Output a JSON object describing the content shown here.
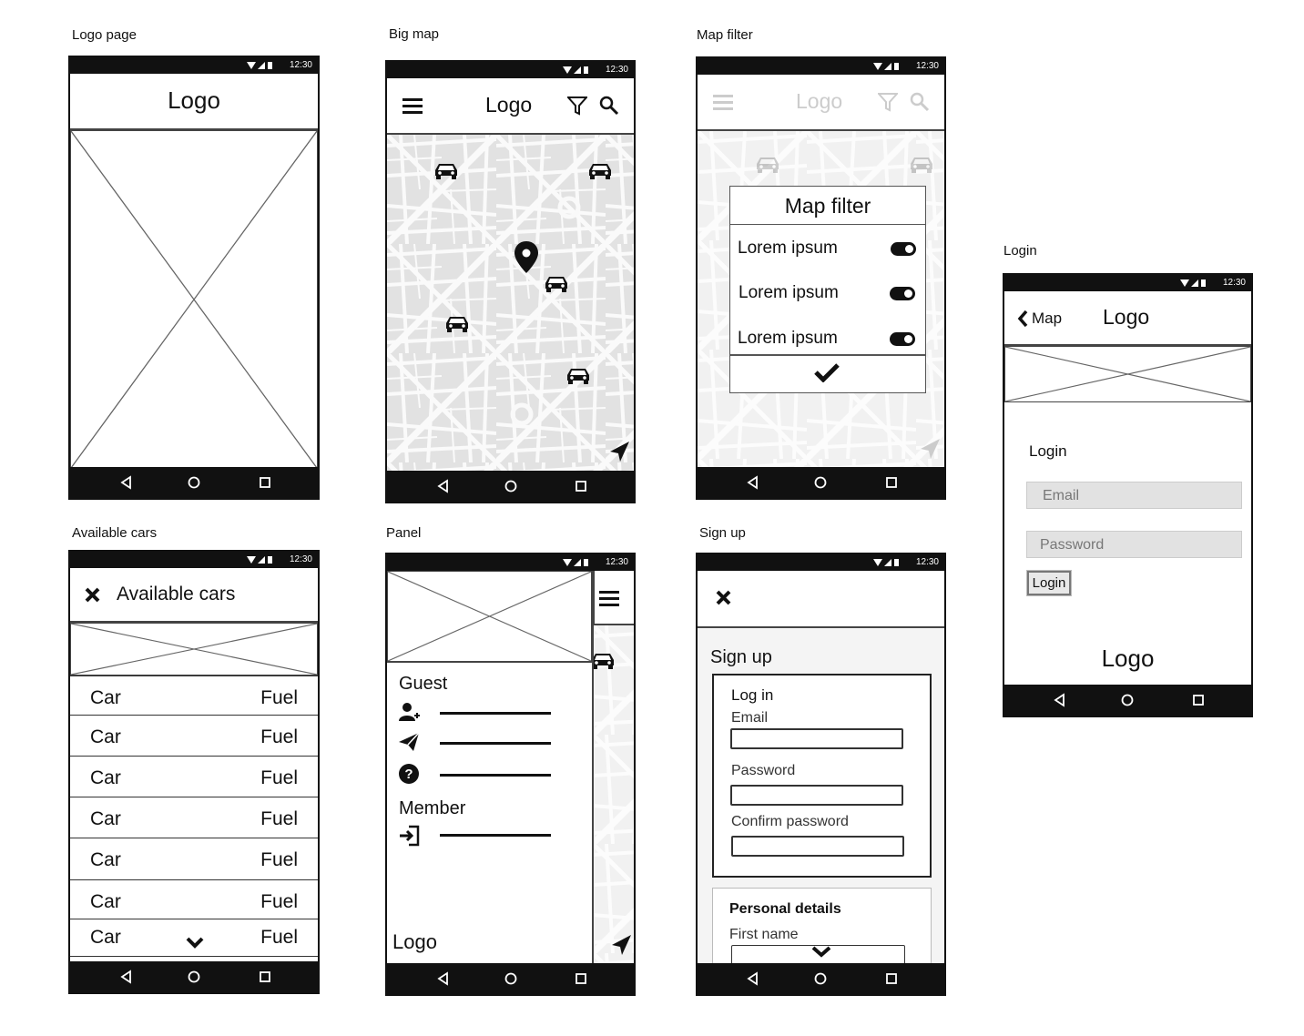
{
  "captions": {
    "logo_page": "Logo page",
    "big_map": "Big map",
    "map_filter": "Map filter",
    "login": "Login",
    "available_cars": "Available cars",
    "panel": "Panel",
    "sign_up": "Sign up"
  },
  "status": {
    "time": "12:30"
  },
  "logo_page": {
    "logo": "Logo"
  },
  "big_map": {
    "logo": "Logo"
  },
  "map_filter": {
    "logo": "Logo",
    "title": "Map filter",
    "options": [
      "Lorem ipsum",
      "Lorem ipsum",
      "Lorem ipsum"
    ]
  },
  "login": {
    "back": "Map",
    "logo": "Logo",
    "heading": "Login",
    "email_placeholder": "Email",
    "password_placeholder": "Password",
    "button": "Login",
    "footer_logo": "Logo"
  },
  "available_cars": {
    "title": "Available cars",
    "rows": [
      {
        "car": "Car",
        "fuel": "Fuel"
      },
      {
        "car": "Car",
        "fuel": "Fuel"
      },
      {
        "car": "Car",
        "fuel": "Fuel"
      },
      {
        "car": "Car",
        "fuel": "Fuel"
      },
      {
        "car": "Car",
        "fuel": "Fuel"
      },
      {
        "car": "Car",
        "fuel": "Fuel"
      },
      {
        "car": "Car",
        "fuel": "Fuel"
      }
    ]
  },
  "panel": {
    "guest": "Guest",
    "member": "Member",
    "logo": "Logo",
    "guest_icons": [
      "user-add-icon",
      "paper-plane-icon",
      "help-icon"
    ],
    "member_icons": [
      "sign-in-icon"
    ]
  },
  "sign_up": {
    "title": "Sign up",
    "login_section": "Log in",
    "email_label": "Email",
    "password_label": "Password",
    "confirm_label": "Confirm password",
    "personal_section": "Personal details",
    "first_name_label": "First name"
  },
  "colors": {
    "frame": "#111111",
    "map_bg": "#e4e4e4",
    "map_roads": "#f7f7f7"
  }
}
